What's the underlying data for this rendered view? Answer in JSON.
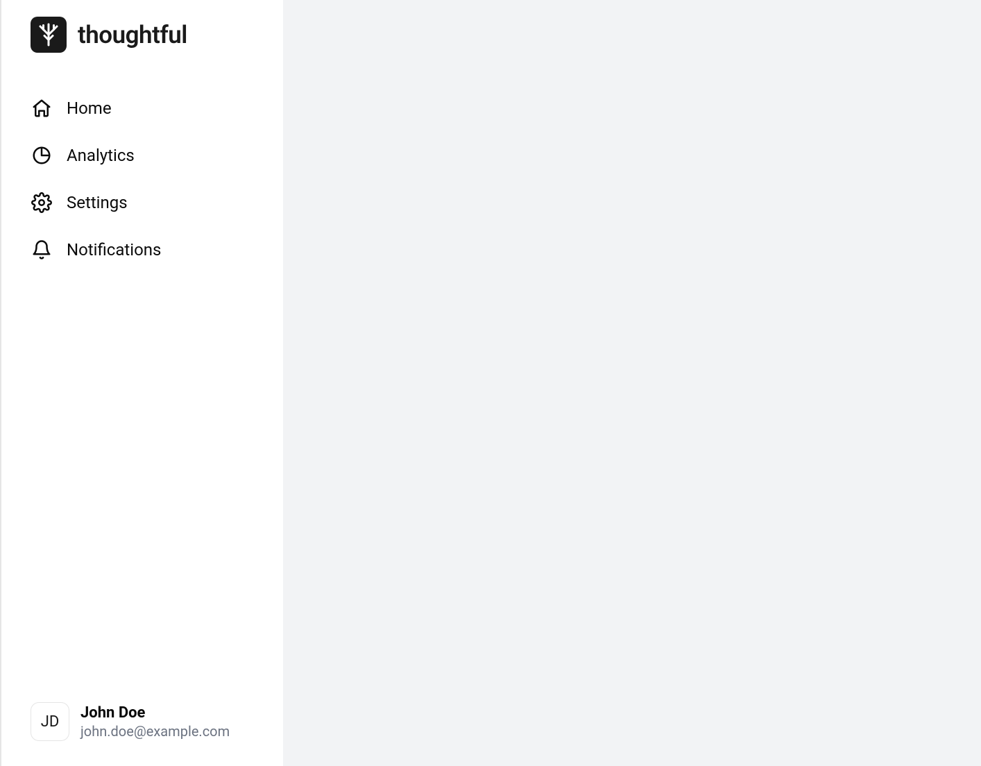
{
  "brand": {
    "name": "thoughtful"
  },
  "sidebar": {
    "items": [
      {
        "label": "Home",
        "icon": "home-icon"
      },
      {
        "label": "Analytics",
        "icon": "pie-chart-icon"
      },
      {
        "label": "Settings",
        "icon": "gear-icon"
      },
      {
        "label": "Notifications",
        "icon": "bell-icon"
      }
    ]
  },
  "user": {
    "initials": "JD",
    "name": "John Doe",
    "email": "john.doe@example.com"
  }
}
